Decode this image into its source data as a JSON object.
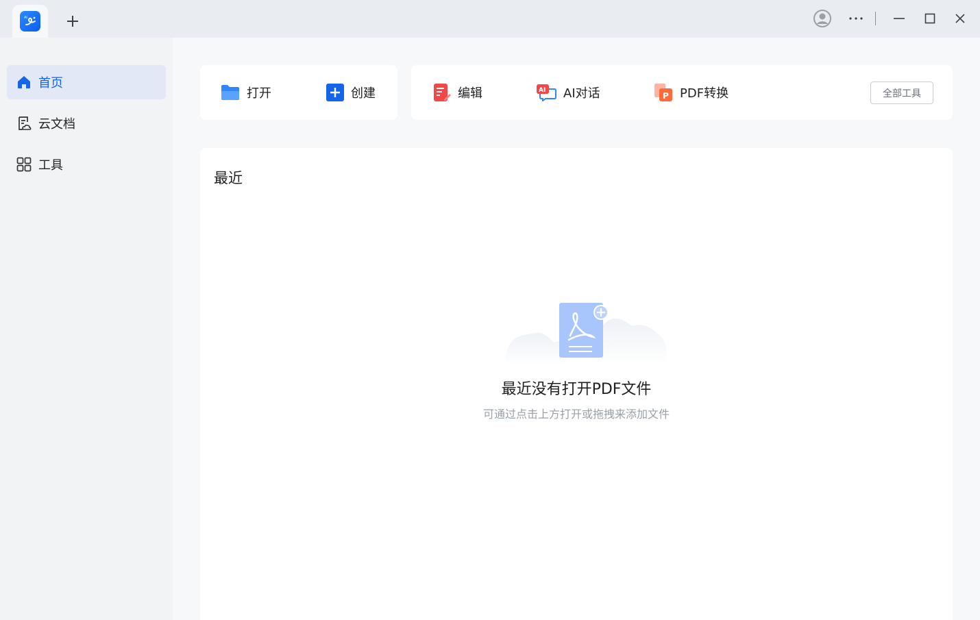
{
  "titlebar": {
    "logo_icon": "app-logo-icon",
    "new_tab_icon": "plus-icon",
    "accent": "#1565e8"
  },
  "sidebar": {
    "items": [
      {
        "label": "首页",
        "icon": "home-icon",
        "active": true
      },
      {
        "label": "云文档",
        "icon": "cloud-doc-icon",
        "active": false
      },
      {
        "label": "工具",
        "icon": "grid-icon",
        "active": false
      }
    ]
  },
  "quick_actions": {
    "open": "打开",
    "create": "创建"
  },
  "tools": {
    "edit": "编辑",
    "ai_chat": "AI对话",
    "ai_badge": "AI",
    "pdf_convert": "PDF转换",
    "pdf_badge": "P",
    "all_tools": "全部工具"
  },
  "recent": {
    "title": "最近",
    "empty_title": "最近没有打开PDF文件",
    "empty_hint": "可通过点击上方打开或拖拽来添加文件"
  }
}
